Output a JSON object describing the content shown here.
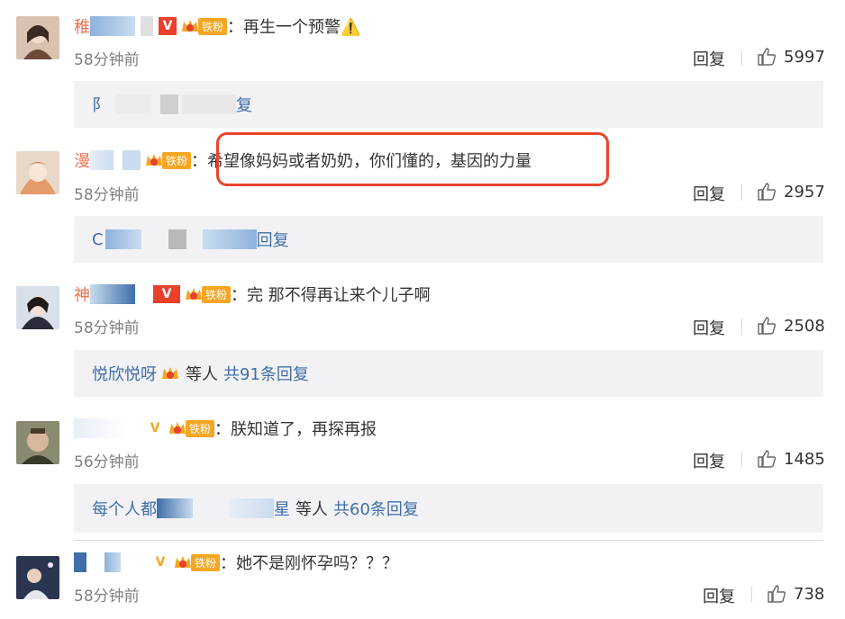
{
  "comments": [
    {
      "name_visible": "稚",
      "text": "再生一个预警⚠️",
      "time": "58分钟前",
      "reply_label": "回复",
      "likes": "5997",
      "fan_label": "铁粉",
      "fan_level": "5",
      "v_mark": "V",
      "sub_reply": {
        "prefix": "阝",
        "suffix": "复"
      }
    },
    {
      "name_visible": "漫",
      "text": "希望像妈妈或者奶奶，你们懂的，基因的力量",
      "time": "58分钟前",
      "reply_label": "回复",
      "likes": "2957",
      "fan_label": "铁粉",
      "fan_level": "5",
      "sub_reply": {
        "prefix": "C",
        "suffix": "回复"
      }
    },
    {
      "name_visible": "神",
      "text": "完 那不得再让来个儿子啊",
      "time": "58分钟前",
      "reply_label": "回复",
      "likes": "2508",
      "fan_label": "铁粉",
      "fan_level": "5",
      "v_mark": "V",
      "sub_reply": {
        "prefix": "悦欣悦呀",
        "fan_level": "1",
        "others": "等人",
        "count": "共91条回复"
      }
    },
    {
      "name_visible": "",
      "text": "朕知道了，再探再报",
      "time": "56分钟前",
      "reply_label": "回复",
      "likes": "1485",
      "fan_label": "铁粉",
      "fan_level": "5",
      "v_mark": "V",
      "sub_reply": {
        "prefix": "每个人都",
        "name_end": "星",
        "others": "等人",
        "count": "共60条回复"
      }
    },
    {
      "name_visible": "",
      "text": "她不是刚怀孕吗？？？",
      "time": "58分钟前",
      "reply_label": "回复",
      "likes": "738",
      "fan_label": "铁粉",
      "fan_level": "5",
      "v_mark": "V"
    }
  ],
  "colors": {
    "name": "#eb7350",
    "link": "#3f6ea8",
    "highlight": "#e8452c",
    "subbox_bg": "#f2f2f5"
  },
  "icons": {
    "like": "thumbs-up-icon",
    "vip": "v-badge-icon",
    "fan": "crown-badge-icon"
  }
}
